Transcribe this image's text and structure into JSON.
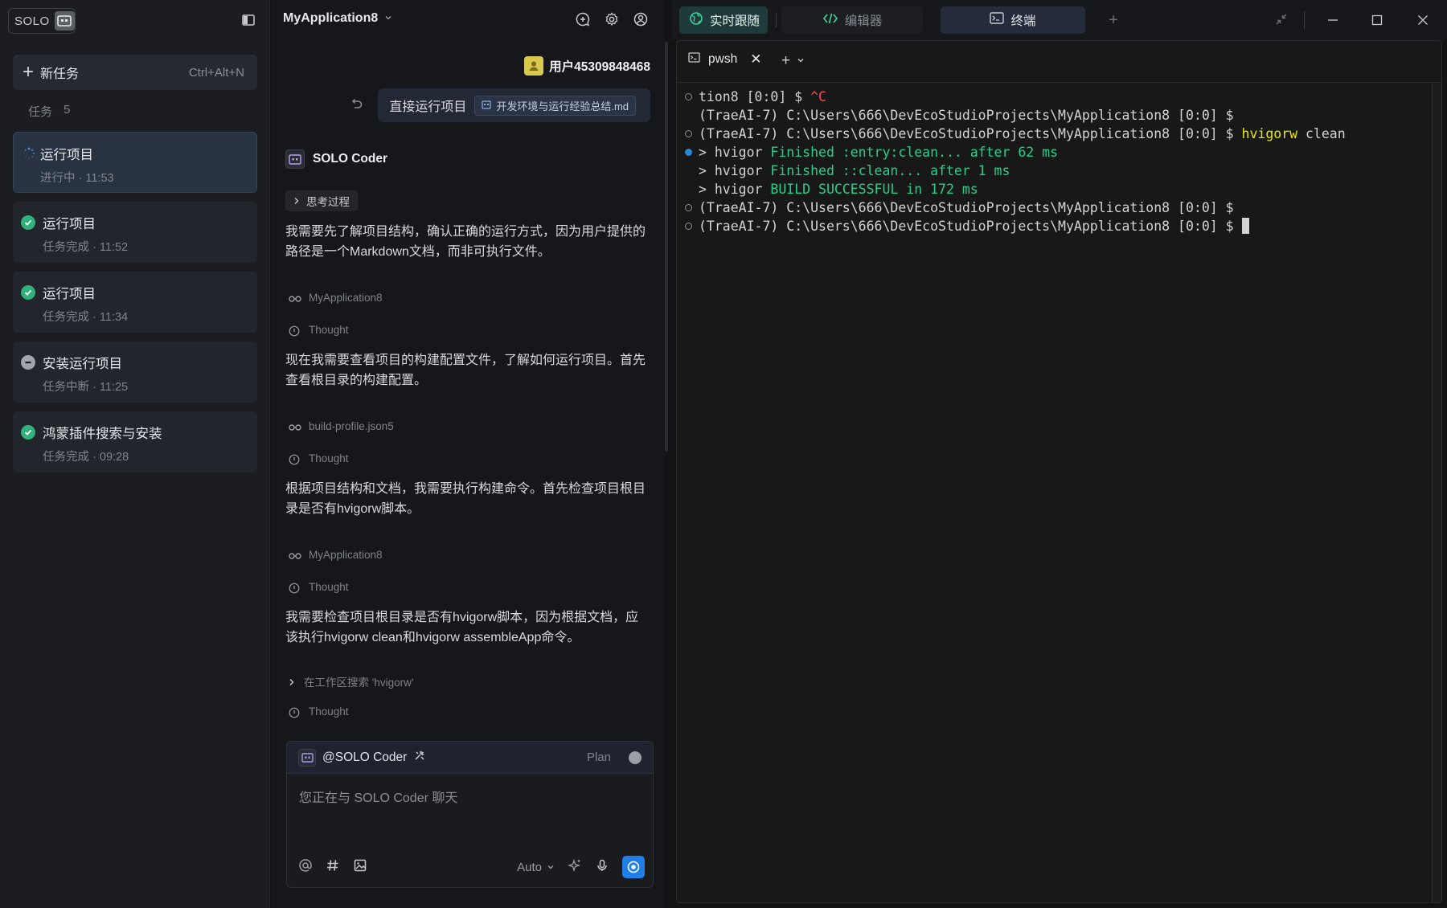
{
  "sidebar": {
    "logo_text": "SOLO",
    "new_task_label": "新任务",
    "new_task_shortcut": "Ctrl+Alt+N",
    "tasks_label": "任务",
    "tasks_count": "5",
    "tasks": [
      {
        "title": "运行项目",
        "sub": "进行中 · 11:53",
        "status": "running"
      },
      {
        "title": "运行项目",
        "sub": "任务完成 · 11:52",
        "status": "done"
      },
      {
        "title": "运行项目",
        "sub": "任务完成 · 11:34",
        "status": "done"
      },
      {
        "title": "安装运行项目",
        "sub": "任务中断 · 11:25",
        "status": "stopped"
      },
      {
        "title": "鸿蒙插件搜索与安装",
        "sub": "任务完成 · 09:28",
        "status": "done"
      }
    ]
  },
  "chat": {
    "project": "MyApplication8",
    "user_name": "用户45309848468",
    "request_text": "直接运行项目",
    "request_file": "开发环境与运行经验总结.md",
    "agent_name": "SOLO Coder",
    "think_label": "思考过程",
    "paragraphs": [
      "我需要先了解项目结构，确认正确的运行方式，因为用户提供的路径是一个Markdown文档，而非可执行文件。",
      "现在我需要查看项目的构建配置文件，了解如何运行项目。首先查看根目录的构建配置。",
      "根据项目结构和文档，我需要执行构建命令。首先检查项目根目录是否有hvigorw脚本。",
      "我需要检查项目根目录是否有hvigorw脚本，因为根据文档，应该执行hvigorw clean和hvigorw assembleApp命令。"
    ],
    "meta": {
      "view1": "MyApplication8",
      "thought": "Thought",
      "view2": "build-profile.json5",
      "view3": "MyApplication8",
      "search": "在工作区搜索 'hvigorw'"
    },
    "input": {
      "mention": "@SOLO Coder",
      "plan": "Plan",
      "placeholder": "您正在与 SOLO Coder 聊天",
      "auto": "Auto"
    }
  },
  "topbar": {
    "live_label": "实时跟随",
    "editor_label": "编辑器",
    "terminal_label": "终端"
  },
  "terminal": {
    "tab_label": "pwsh",
    "lines": [
      {
        "dot": "hollow",
        "segs": [
          {
            "t": "tion8 [0:0] $ ",
            "c": ""
          },
          {
            "t": "^C",
            "c": "red"
          }
        ]
      },
      {
        "dot": "none",
        "segs": [
          {
            "t": "(TraeAI-7) C:\\Users\\666\\DevEcoStudioProjects\\MyApplication8 [0:0] $",
            "c": ""
          }
        ]
      },
      {
        "dot": "hollow",
        "segs": [
          {
            "t": "(TraeAI-7) C:\\Users\\666\\DevEcoStudioProjects\\MyApplication8 [0:0] $ ",
            "c": ""
          },
          {
            "t": "hvigorw",
            "c": "yellow"
          },
          {
            "t": " clean",
            "c": ""
          }
        ]
      },
      {
        "dot": "blue",
        "segs": [
          {
            "t": "> hvigor ",
            "c": ""
          },
          {
            "t": "Finished :entry:clean... after 62 ms",
            "c": "green"
          }
        ]
      },
      {
        "dot": "none",
        "segs": [
          {
            "t": "> hvigor ",
            "c": ""
          },
          {
            "t": "Finished ::clean... after 1 ms",
            "c": "green"
          }
        ]
      },
      {
        "dot": "none",
        "segs": [
          {
            "t": "> hvigor ",
            "c": ""
          },
          {
            "t": "BUILD SUCCESSFUL in 172 ms",
            "c": "green"
          }
        ]
      },
      {
        "dot": "hollow",
        "segs": [
          {
            "t": "(TraeAI-7) C:\\Users\\666\\DevEcoStudioProjects\\MyApplication8 [0:0] $",
            "c": ""
          }
        ]
      },
      {
        "dot": "hollow",
        "segs": [
          {
            "t": "(TraeAI-7) C:\\Users\\666\\DevEcoStudioProjects\\MyApplication8 [0:0] $ ",
            "c": ""
          }
        ],
        "cursor": true
      }
    ]
  },
  "colors": {
    "accent_blue": "#1f7fe6",
    "success_green": "#2fb37a",
    "terminal_green": "#23d18b",
    "terminal_yellow": "#e5e510",
    "terminal_red": "#f14c4c"
  }
}
